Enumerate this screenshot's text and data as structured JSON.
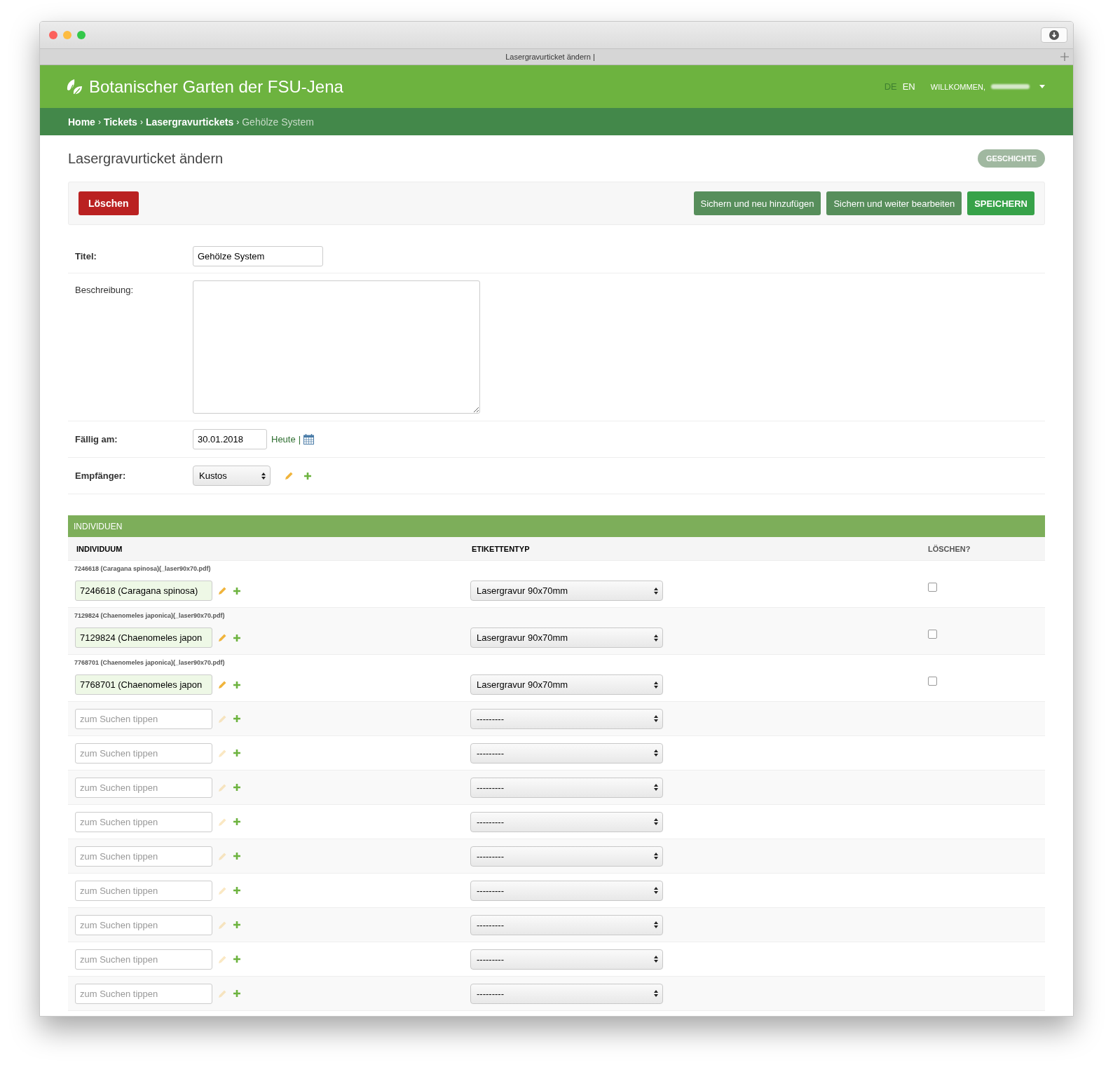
{
  "browser": {
    "tab_title": "Lasergravurticket ändern |"
  },
  "header": {
    "site_title": "Botanischer Garten der FSU-Jena",
    "languages": [
      {
        "label": "DE",
        "selected": true
      },
      {
        "label": "EN",
        "selected": false
      }
    ],
    "welcome": "WILLKOMMEN,"
  },
  "breadcrumbs": [
    {
      "label": "Home",
      "kind": "link"
    },
    {
      "label": "Tickets",
      "kind": "link"
    },
    {
      "label": "Lasergravurtickets",
      "kind": "link"
    },
    {
      "label": "Gehölze System",
      "kind": "current"
    }
  ],
  "breadcrumb_separator": "›",
  "page_title": "Lasergravurticket ändern",
  "history_button": "GESCHICHTE",
  "actions": {
    "delete": "Löschen",
    "buttons": [
      {
        "label": "Sichern und neu hinzufügen",
        "kind": "secondary"
      },
      {
        "label": "Sichern und weiter bearbeiten",
        "kind": "secondary"
      },
      {
        "label": "SPEICHERN",
        "kind": "primary"
      }
    ]
  },
  "fields": [
    {
      "kind": "text",
      "label": "Titel:",
      "required": true,
      "value": "Gehölze System"
    },
    {
      "kind": "textarea",
      "label": "Beschreibung:",
      "required": false
    },
    {
      "kind": "date",
      "label": "Fällig am:",
      "required": true,
      "value": "30.01.2018",
      "today_link": "Heute",
      "separator": "|"
    },
    {
      "kind": "select",
      "label": "Empfänger:",
      "required": true,
      "value": "Kustos"
    }
  ],
  "inline": {
    "title": "INDIVIDUEN",
    "columns": [
      "INDIVIDUUM",
      "ETIKETTENTYP",
      "LÖSCHEN?"
    ],
    "rows": [
      {
        "kind": "filled",
        "caption": "7246618 (Caragana spinosa)(_laser90x70.pdf)",
        "value": "7246618 (Caragana spinosa)",
        "label_type": "Lasergravur 90x70mm",
        "delete_checked": false
      },
      {
        "kind": "filled",
        "caption": "7129824 (Chaenomeles japonica)(_laser90x70.pdf)",
        "value": "7129824 (Chaenomeles japon",
        "label_type": "Lasergravur 90x70mm",
        "delete_checked": false
      },
      {
        "kind": "filled",
        "caption": "7768701 (Chaenomeles japonica)(_laser90x70.pdf)",
        "value": "7768701 (Chaenomeles japon",
        "label_type": "Lasergravur 90x70mm",
        "delete_checked": false
      },
      {
        "kind": "empty",
        "placeholder": "zum Suchen tippen",
        "label_type": "---------"
      },
      {
        "kind": "empty",
        "placeholder": "zum Suchen tippen",
        "label_type": "---------"
      },
      {
        "kind": "empty",
        "placeholder": "zum Suchen tippen",
        "label_type": "---------"
      },
      {
        "kind": "empty",
        "placeholder": "zum Suchen tippen",
        "label_type": "---------"
      },
      {
        "kind": "empty",
        "placeholder": "zum Suchen tippen",
        "label_type": "---------"
      },
      {
        "kind": "empty",
        "placeholder": "zum Suchen tippen",
        "label_type": "---------"
      },
      {
        "kind": "empty",
        "placeholder": "zum Suchen tippen",
        "label_type": "---------"
      },
      {
        "kind": "empty",
        "placeholder": "zum Suchen tippen",
        "label_type": "---------"
      },
      {
        "kind": "empty",
        "placeholder": "zum Suchen tippen",
        "label_type": "---------"
      }
    ]
  }
}
